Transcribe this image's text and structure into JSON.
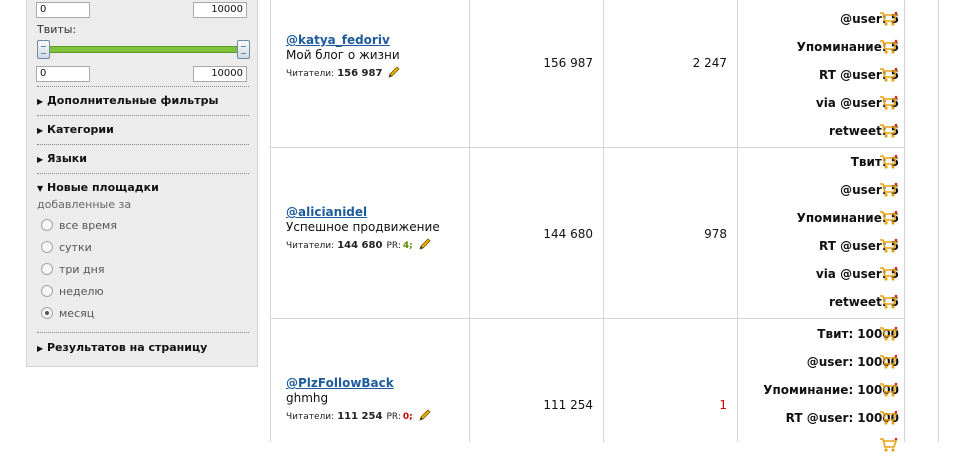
{
  "filters": {
    "top_range": {
      "min": "0",
      "max": "10000"
    },
    "tweets": {
      "label": "Твиты:",
      "min": "0",
      "max": "10000"
    },
    "sections": {
      "additional": "Дополнительные фильтры",
      "categories": "Категории",
      "languages": "Языки",
      "new_sites": "Новые площадки",
      "per_page": "Результатов на страницу"
    },
    "added_for_label": "добавленные за",
    "period_options": [
      "все время",
      "сутки",
      "три дня",
      "неделю",
      "месяц"
    ],
    "period_selected": "месяц"
  },
  "rows": [
    {
      "handle": "@katya_fedoriv",
      "description": "Мой блог о жизни",
      "readers_label": "Читатели:",
      "readers": "156 987",
      "followers": "156 987",
      "count": "2 247",
      "prices": [
        {
          "label": "@user:",
          "value": "5"
        },
        {
          "label": "Упоминание:",
          "value": "5"
        },
        {
          "label": "RT @user:",
          "value": "5"
        },
        {
          "label": "via @user:",
          "value": "5"
        },
        {
          "label": "retweet:",
          "value": "5"
        }
      ]
    },
    {
      "handle": "@alicianidel",
      "description": "Успешное продвижение",
      "readers_label": "Читатели:",
      "readers": "144 680",
      "pr_label": "PR:",
      "pr": "4;",
      "followers": "144 680",
      "count": "978",
      "prices": [
        {
          "label": "Твит:",
          "value": "5"
        },
        {
          "label": "@user:",
          "value": "5"
        },
        {
          "label": "Упоминание:",
          "value": "5"
        },
        {
          "label": "RT @user:",
          "value": "5"
        },
        {
          "label": "via @user:",
          "value": "5"
        },
        {
          "label": "retweet:",
          "value": "5"
        }
      ]
    },
    {
      "handle": "@PlzFollowBack",
      "description": "ghmhg",
      "readers_label": "Читатели:",
      "readers": "111 254",
      "pr_label": "PR:",
      "pr": "0;",
      "followers": "111 254",
      "count": "1",
      "prices": [
        {
          "label": "Твит:",
          "value": "10000"
        },
        {
          "label": "@user:",
          "value": "10000"
        },
        {
          "label": "Упоминание:",
          "value": "10000"
        },
        {
          "label": "RT @user:",
          "value": "10000"
        }
      ]
    }
  ],
  "colors": {
    "link": "#1e5b9c",
    "slider": "#7ec23b",
    "pr_good": "#5b8a00",
    "pr_bad": "#cc0000",
    "cart": "#e8a317"
  },
  "icons": {
    "edit": "pencil-icon",
    "order": "cart-icon",
    "section": "triangle-icon"
  }
}
